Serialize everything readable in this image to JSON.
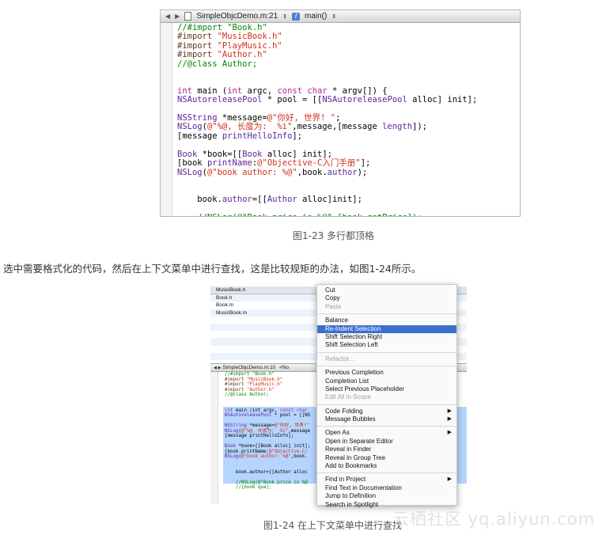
{
  "figure1": {
    "jump_bar": {
      "file": "SimpleObjcDemo.m:21",
      "function": "main()"
    },
    "code_lines": [
      [
        {
          "c": "com",
          "t": "//#import \"Book.h\""
        }
      ],
      [
        {
          "c": "pp",
          "t": "#import "
        },
        {
          "c": "str",
          "t": "\"MusicBook.h\""
        }
      ],
      [
        {
          "c": "pp",
          "t": "#import "
        },
        {
          "c": "str",
          "t": "\"PlayMusic.h\""
        }
      ],
      [
        {
          "c": "pp",
          "t": "#import "
        },
        {
          "c": "str",
          "t": "\"Author.h\""
        }
      ],
      [
        {
          "c": "com",
          "t": "//@class Author;"
        }
      ],
      [],
      [],
      [
        {
          "c": "kw",
          "t": "int"
        },
        {
          "c": "plain",
          "t": " main ("
        },
        {
          "c": "kw",
          "t": "int"
        },
        {
          "c": "plain",
          "t": " argc, "
        },
        {
          "c": "kw",
          "t": "const char"
        },
        {
          "c": "plain",
          "t": " * argv[]) {"
        }
      ],
      [
        {
          "c": "cls",
          "t": "NSAutoreleasePool"
        },
        {
          "c": "plain",
          "t": " * pool = [["
        },
        {
          "c": "cls",
          "t": "NSAutoreleasePool"
        },
        {
          "c": "plain",
          "t": " alloc] init];"
        }
      ],
      [],
      [
        {
          "c": "cls",
          "t": "NSString"
        },
        {
          "c": "plain",
          "t": " *message="
        },
        {
          "c": "str",
          "t": "@\"你好, 世界! \""
        },
        {
          "c": "plain",
          "t": ";"
        }
      ],
      [
        {
          "c": "cls",
          "t": "NSLog"
        },
        {
          "c": "plain",
          "t": "("
        },
        {
          "c": "str",
          "t": "@\"%@, 长度为:  %i\""
        },
        {
          "c": "plain",
          "t": ",message,[message "
        },
        {
          "c": "cls",
          "t": "length"
        },
        {
          "c": "plain",
          "t": "]);"
        }
      ],
      [
        {
          "c": "plain",
          "t": "[message "
        },
        {
          "c": "cls",
          "t": "printHelloInfo"
        },
        {
          "c": "plain",
          "t": "];"
        }
      ],
      [],
      [
        {
          "c": "cls",
          "t": "Book"
        },
        {
          "c": "plain",
          "t": " *book=[["
        },
        {
          "c": "cls",
          "t": "Book"
        },
        {
          "c": "plain",
          "t": " alloc] init];"
        }
      ],
      [
        {
          "c": "plain",
          "t": "[book "
        },
        {
          "c": "cls",
          "t": "printName"
        },
        {
          "c": "plain",
          "t": ":"
        },
        {
          "c": "str",
          "t": "@\"Objective-C入门手册\""
        },
        {
          "c": "plain",
          "t": "];"
        }
      ],
      [
        {
          "c": "cls",
          "t": "NSLog"
        },
        {
          "c": "plain",
          "t": "("
        },
        {
          "c": "str",
          "t": "@\"book author: %@\""
        },
        {
          "c": "plain",
          "t": ",book."
        },
        {
          "c": "cls",
          "t": "author"
        },
        {
          "c": "plain",
          "t": ");"
        }
      ],
      [],
      [],
      [
        {
          "c": "plain",
          "t": "    book."
        },
        {
          "c": "cls",
          "t": "author"
        },
        {
          "c": "plain",
          "t": "=[["
        },
        {
          "c": "cls",
          "t": "Author"
        },
        {
          "c": "plain",
          "t": " alloc]init];"
        }
      ],
      [],
      [
        {
          "c": "com",
          "t": "    //NSLog(@\"Book price is %@\",[book getPrice]);"
        }
      ]
    ],
    "caption": "图1-23   多行都顶格"
  },
  "paragraph": "选中需要格式化的代码，然后在上下文菜单中进行查找，这是比较规矩的办法，如图1-24所示。",
  "figure2": {
    "file_list": [
      "MusicBook.h",
      "Book.h",
      "Book.m",
      "MusicBook.m"
    ],
    "jump_bar": "SimpleObjcDemo.m:10",
    "jump_bar_extra": "<No",
    "code_lines": [
      [
        {
          "c": "com",
          "t": "//#import \"Book.h\""
        }
      ],
      [
        {
          "c": "pp",
          "t": "#import "
        },
        {
          "c": "str",
          "t": "\"MusicBook.h\""
        }
      ],
      [
        {
          "c": "pp",
          "t": "#import "
        },
        {
          "c": "str",
          "t": "\"PlayMusic.h\""
        }
      ],
      [
        {
          "c": "pp",
          "t": "#import "
        },
        {
          "c": "str",
          "t": "\"Author.h\""
        }
      ],
      [
        {
          "c": "com",
          "t": "//@class Author;"
        }
      ],
      [],
      [],
      [
        {
          "c": "kw",
          "t": "int"
        },
        {
          "c": "plain",
          "t": " main (int argc, "
        },
        {
          "c": "kw",
          "t": "const char"
        }
      ],
      [
        {
          "c": "cls",
          "t": "NSAutoreleasePool"
        },
        {
          "c": "plain",
          "t": " * pool = [[NS"
        }
      ],
      [],
      [
        {
          "c": "cls",
          "t": "NSString"
        },
        {
          "c": "plain",
          "t": " *message="
        },
        {
          "c": "str",
          "t": "@\"你好, 世界!\""
        }
      ],
      [
        {
          "c": "cls",
          "t": "NSLog"
        },
        {
          "c": "plain",
          "t": "("
        },
        {
          "c": "str",
          "t": "@\"%@, 长度为:  %i\""
        },
        {
          "c": "plain",
          "t": ",message"
        }
      ],
      [
        {
          "c": "plain",
          "t": "[message printHelloInfo];"
        }
      ],
      [],
      [
        {
          "c": "cls",
          "t": "Book"
        },
        {
          "c": "plain",
          "t": " *book=[[Book alloc] init];"
        }
      ],
      [
        {
          "c": "plain",
          "t": "[book printName:"
        },
        {
          "c": "str",
          "t": "@\"Objective-C/"
        }
      ],
      [
        {
          "c": "cls",
          "t": "NSLog"
        },
        {
          "c": "plain",
          "t": "("
        },
        {
          "c": "str",
          "t": "@\"book author: %@\""
        },
        {
          "c": "plain",
          "t": ",book."
        }
      ],
      [],
      [],
      [
        {
          "c": "plain",
          "t": "    book.author=[[Author alloc"
        }
      ],
      [],
      [
        {
          "c": "com",
          "t": "    //NSLog(@\"Book price is %@"
        }
      ],
      [
        {
          "c": "com",
          "t": "    //[book qua];"
        }
      ]
    ],
    "caption": "图1-24   在上下文菜单中进行查找"
  },
  "context_menu": {
    "groups": [
      [
        {
          "label": "Cut",
          "state": "normal"
        },
        {
          "label": "Copy",
          "state": "normal"
        },
        {
          "label": "Paste",
          "state": "disabled"
        }
      ],
      [
        {
          "label": "Balance",
          "state": "normal"
        },
        {
          "label": "Re-Indent Selection",
          "state": "selected"
        },
        {
          "label": "Shift Selection Right",
          "state": "normal"
        },
        {
          "label": "Shift Selection Left",
          "state": "normal"
        }
      ],
      [
        {
          "label": "Refactor...",
          "state": "disabled"
        }
      ],
      [
        {
          "label": "Previous Completion",
          "state": "normal"
        },
        {
          "label": "Completion List",
          "state": "normal"
        },
        {
          "label": "Select Previous Placeholder",
          "state": "normal"
        },
        {
          "label": "Edit All in Scope",
          "state": "disabled"
        }
      ],
      [
        {
          "label": "Code Folding",
          "state": "normal",
          "submenu": true
        },
        {
          "label": "Message Bubbles",
          "state": "normal",
          "submenu": true
        }
      ],
      [
        {
          "label": "Open As",
          "state": "normal",
          "submenu": true
        },
        {
          "label": "Open in Separate Editor",
          "state": "normal"
        },
        {
          "label": "Reveal in Finder",
          "state": "normal"
        },
        {
          "label": "Reveal in Group Tree",
          "state": "normal"
        },
        {
          "label": "Add to Bookmarks",
          "state": "normal"
        }
      ],
      [
        {
          "label": "Find in Project",
          "state": "normal",
          "submenu": true
        },
        {
          "label": "Find Text in Documentation",
          "state": "normal"
        },
        {
          "label": "Jump to Definition",
          "state": "normal"
        },
        {
          "label": "Search in Spotlight",
          "state": "normal"
        }
      ]
    ],
    "submenu_glyph": "▶"
  },
  "watermark": "云栖社区 yq.aliyun.com",
  "nav_glyphs": {
    "back": "◀",
    "forward": "▶",
    "function_icon": "f"
  }
}
